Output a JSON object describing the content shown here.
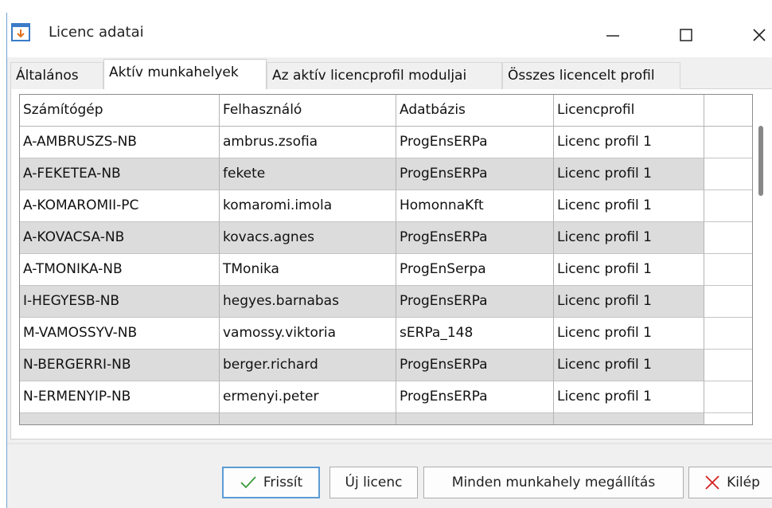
{
  "window": {
    "title": "Licenc adatai",
    "controls": {
      "minimize": "—",
      "maximize": "☐",
      "close": "✕"
    }
  },
  "tabs": [
    {
      "label": "Általános",
      "active": false
    },
    {
      "label": "Aktív munkahelyek",
      "active": true
    },
    {
      "label": "Az aktív licencprofil moduljai",
      "active": false
    },
    {
      "label": "Összes licencelt profil",
      "active": false
    }
  ],
  "table": {
    "columns": [
      "Számítógép",
      "Felhasználó",
      "Adatbázis",
      "Licencprofil",
      ""
    ],
    "rows": [
      [
        "A-AMBRUSZS-NB",
        "ambrus.zsofia",
        "ProgEnsERPa",
        "Licenc profil 1"
      ],
      [
        "A-FEKETEA-NB",
        "fekete",
        "ProgEnsERPa",
        "Licenc profil 1"
      ],
      [
        "A-KOMAROMII-PC",
        "komaromi.imola",
        "HomonnaKft",
        "Licenc profil 1"
      ],
      [
        "A-KOVACSA-NB",
        "kovacs.agnes",
        "ProgEnsERPa",
        "Licenc profil 1"
      ],
      [
        "A-TMONIKA-NB",
        "TMonika",
        "ProgEnSerpa",
        "Licenc profil 1"
      ],
      [
        "I-HEGYESB-NB",
        "hegyes.barnabas",
        "ProgEnsERPa",
        "Licenc profil 1"
      ],
      [
        "M-VAMOSSYV-NB",
        "vamossy.viktoria",
        "sERPa_148",
        "Licenc profil 1"
      ],
      [
        "N-BERGERRI-NB",
        "berger.richard",
        "ProgEnsERPa",
        "Licenc profil 1"
      ],
      [
        "N-ERMENYIP-NB",
        "ermenyi.peter",
        "ProgEnsERPa",
        "Licenc profil 1"
      ],
      [
        "",
        "",
        "",
        ""
      ]
    ]
  },
  "buttons": {
    "refresh": "Frissít",
    "new_license": "Új licenc",
    "stop_all": "Minden munkahely megállítás",
    "exit": "Kilép"
  },
  "colors": {
    "accent": "#5b9bd5",
    "title_icon": "#e07020",
    "check_icon": "#3a9a3a",
    "exit_icon": "#d42020",
    "row_alt": "#dcdcdc"
  },
  "icons": {
    "title": "download-window-icon",
    "refresh": "check-icon",
    "exit": "x-icon"
  }
}
